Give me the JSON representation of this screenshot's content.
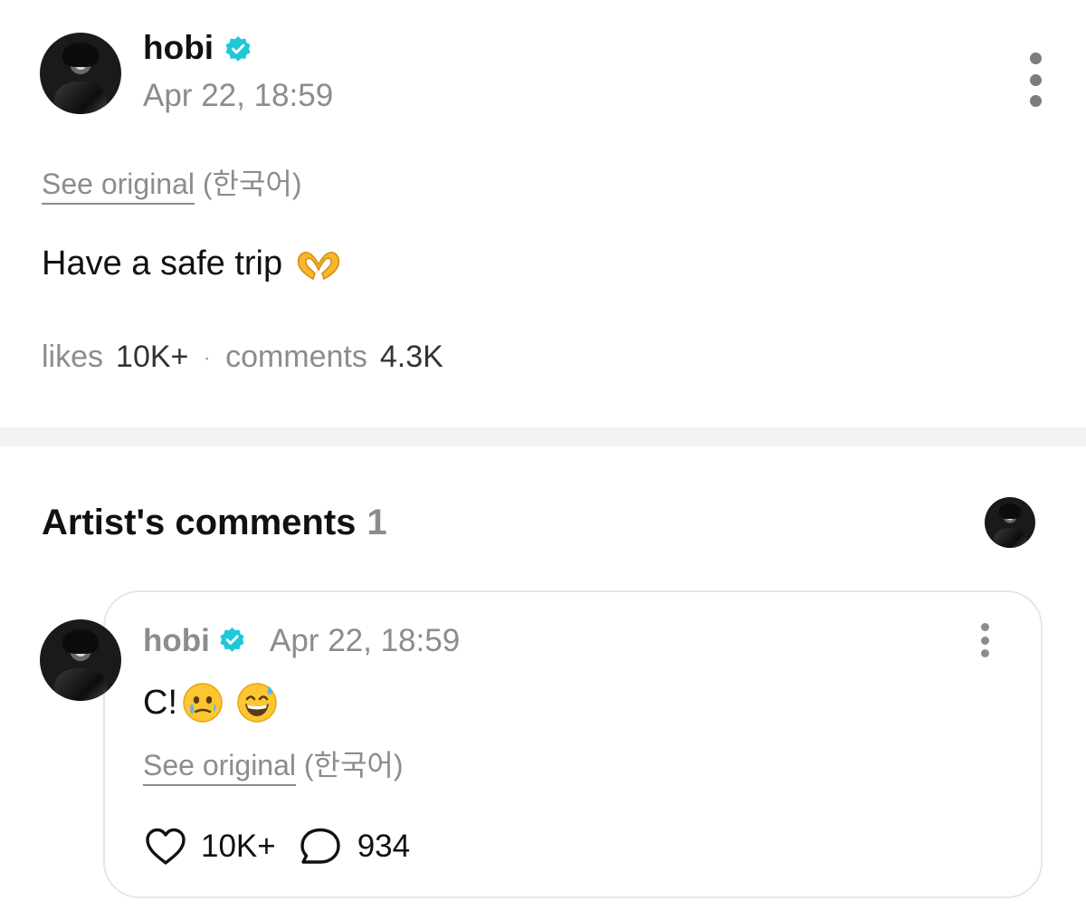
{
  "post": {
    "author": "hobi",
    "verified_icon": "verified-badge-icon",
    "timestamp": "Apr 22, 18:59",
    "see_original_link": "See original",
    "original_language": "(한국어)",
    "text": "Have a safe trip",
    "text_emoji": "heart-hands-emoji",
    "likes_label": "likes",
    "likes_count": "10K+",
    "stats_separator": "·",
    "comments_label": "comments",
    "comments_count": "4.3K"
  },
  "artist_comments": {
    "title": "Artist's comments",
    "count": "1",
    "comment": {
      "author": "hobi",
      "timestamp": "Apr 22, 18:59",
      "text": "C!",
      "emojis": [
        "face-holding-back-tears-emoji",
        "grinning-face-with-sweat-emoji"
      ],
      "see_original_link": "See original",
      "original_language": "(한국어)",
      "like_count": "10K+",
      "reply_count": "934"
    }
  },
  "colors": {
    "verified": "#1ec8d8",
    "muted_text": "#8c8c8c",
    "divider": "#f2f2f2",
    "card_border": "#e6e6e6"
  }
}
